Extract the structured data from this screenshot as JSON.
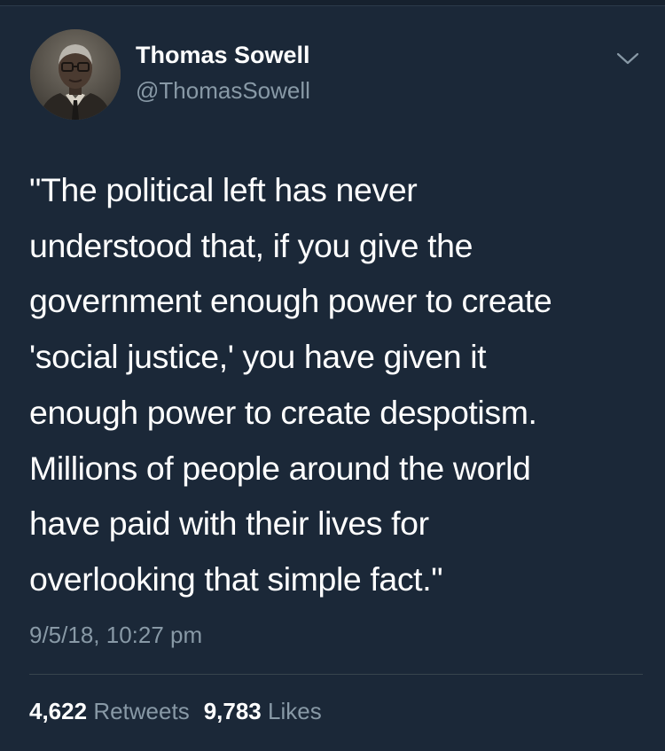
{
  "author": {
    "name": "Thomas Sowell",
    "handle": "@ThomasSowell",
    "avatar_icon": "profile-photo"
  },
  "menu": {
    "icon": "chevron-down-icon"
  },
  "tweet": {
    "text": "\"The political left has never\nunderstood that, if you give the\ngovernment enough power to create\n'social justice,' you have given it\nenough power to create despotism.\nMillions of people around the world\nhave paid with their lives for\noverlooking that simple fact.\"",
    "timestamp": "9/5/18, 10:27 pm"
  },
  "stats": {
    "retweets_count": "4,622",
    "retweets_label": "Retweets",
    "likes_count": "9,783",
    "likes_label": "Likes"
  },
  "colors": {
    "background": "#1b2838",
    "primary_text": "#ffffff",
    "secondary_text": "#8899a6",
    "divider": "#38444d"
  }
}
